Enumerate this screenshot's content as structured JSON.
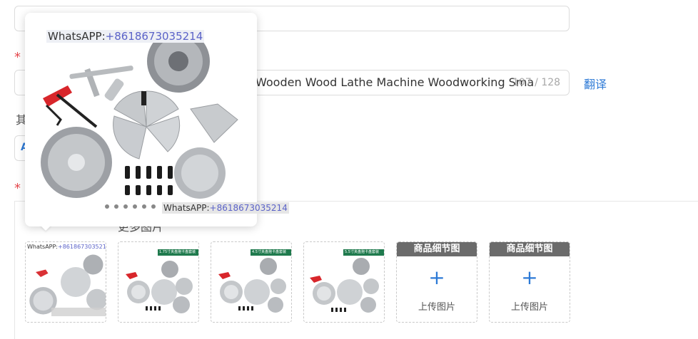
{
  "form": {
    "title_value": "Wooden Wood Lathe Machine Woodworking Sma",
    "char_count": "107 / 128",
    "translate_label": "翻译",
    "other_label": "其",
    "required_mark": "*",
    "small_box_glyph": "A"
  },
  "images": {
    "section_label": "更多图片",
    "thumbnails": [
      {
        "badge": ""
      },
      {
        "badge": "1.75寸夹盘抱卡盘套装"
      },
      {
        "badge": "4.5寸夹盘抱卡盘套装"
      },
      {
        "badge": "5.5寸夹盘抱卡盘套装"
      }
    ],
    "upload_slots": [
      {
        "header": "商品细节图",
        "plus": "+",
        "label": "上传图片"
      },
      {
        "header": "商品细节图",
        "plus": "+",
        "label": "上传图片"
      }
    ]
  },
  "preview": {
    "watermark_top_prefix": "WhatsAPP:",
    "watermark_top_number": "+8618673035214",
    "watermark_bottom_prefix": "WhatsAPP:",
    "watermark_bottom_number": "+8618673035214"
  },
  "colors": {
    "accent": "#2d7ad6",
    "required": "#e5484d",
    "header_gray": "#6b6b6b",
    "badge_green": "#1f7a4d",
    "tool_red": "#d8262b"
  }
}
